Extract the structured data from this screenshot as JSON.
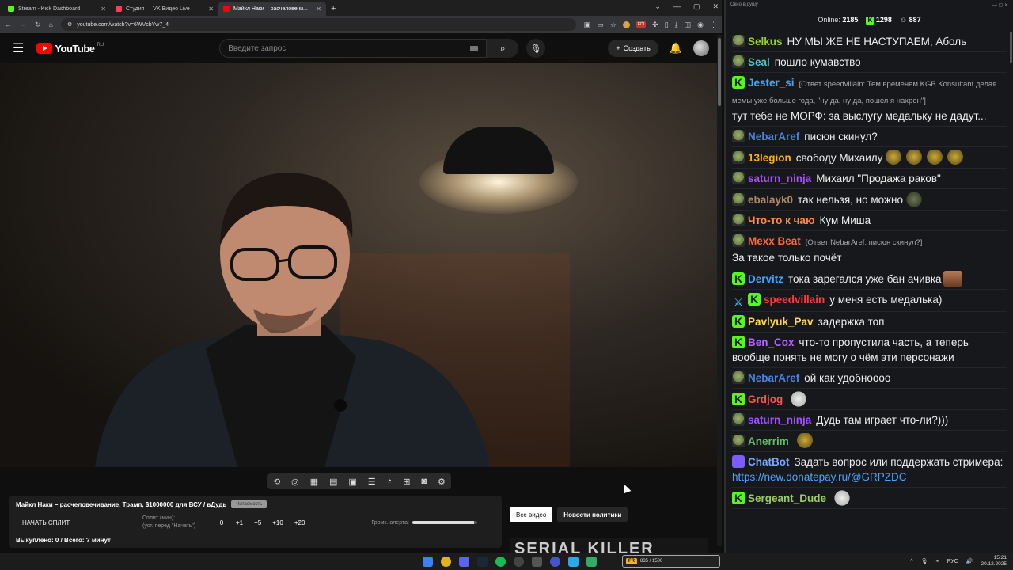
{
  "browser": {
    "tabs": [
      {
        "title": "Stream - Kick Dashboard",
        "color": "#53fc18",
        "active": false
      },
      {
        "title": "Студия — VK Видео Live",
        "color": "#ff3b5c",
        "active": false
      },
      {
        "title": "Майкл Наки – расчеловечи...",
        "color": "#ff0000",
        "active": true
      }
    ],
    "url": "youtube.com/watch?v=6WVcbYw7_4",
    "ext_badge": "EDI"
  },
  "youtube": {
    "logo_text": "YouTube",
    "region": "RU",
    "search_placeholder": "Введите запрос",
    "create_label": "Создать"
  },
  "panel": {
    "title": "Майкл Наки – расчеловечивание, Трамп, $1000000 для ВСУ / вДудь",
    "tag": "Читаемость",
    "start_split": "НАЧАТЬ СПЛИТ",
    "split_label": "Сплит (мин):",
    "split_hint": "(уст. перед \"Начать\")",
    "split_value": "0",
    "increments": [
      "+1",
      "+5",
      "+10",
      "+20"
    ],
    "alert_label": "Громк. алерта:",
    "alert_volume": 0.95,
    "footer": "Выкуплено: 0 / Всего: ? минут"
  },
  "chips": {
    "all": "Все видео",
    "policy": "Новости политики"
  },
  "thumb_text": "SERIAL KILLER",
  "chat": {
    "window_title": "Окно в душу",
    "online_label": "Online:",
    "online_count": "2185",
    "kick_count": "1298",
    "vk_count": "887",
    "messages": [
      {
        "badge": "pepe",
        "nick": "Selkus",
        "color": "#9acd32",
        "text": "НУ МЫ ЖЕ НЕ НАСТУПАЕМ, Аболь"
      },
      {
        "badge": "pepe",
        "nick": "Seal",
        "color": "#4fc3c3",
        "text": "пошло кумавство"
      },
      {
        "badge": "kick",
        "nick": "Jester_si",
        "color": "#3da8ff",
        "reply": "[Ответ speedvillain: Тем временем KGB Konsultant делая мемы уже больше года, \"ну да, ну да, пошел я нахрен\"]",
        "text": "тут тебе не МОРФ: за выслугу медальку не дадут..."
      },
      {
        "badge": "pepe",
        "nick": "NebarAref",
        "color": "#4a82e0",
        "text": "писюн скинул?"
      },
      {
        "badge": "pepe",
        "nick": "13legion",
        "color": "#ffb300",
        "text": "свободу  Михаилу",
        "emotes": 4
      },
      {
        "badge": "pepe",
        "nick": "saturn_ninja",
        "color": "#a64dff",
        "text": "Михаил \"Продажа раков\""
      },
      {
        "badge": "pepe",
        "nick": "ebalayk0",
        "color": "#b08968",
        "text": "так нельзя, но можно",
        "emote": "frog"
      },
      {
        "badge": "pepe",
        "nick": "Что-то к чаю",
        "color": "#ff8c42",
        "text": "Кум Миша"
      },
      {
        "badge": "pepe",
        "nick": "Mexx Beat",
        "color": "#ff6a3d",
        "reply": "[Ответ NebarAref: писюн скинул?]",
        "text": "За такое только почёт"
      },
      {
        "badge": "kick",
        "nick": "Dervitz",
        "color": "#3da8ff",
        "text": "тока зарегался уже бан ачивка",
        "emote": "face"
      },
      {
        "badge": "kick",
        "prebadge": "sword",
        "nick": "speedvillain",
        "color": "#ff3b3b",
        "text": "у меня есть медалька)"
      },
      {
        "badge": "kick",
        "nick": "Pavlyuk_Pav",
        "color": "#ffd54f",
        "text": "задержка топ"
      },
      {
        "badge": "kick",
        "nick": "Ben_Cox",
        "color": "#b561ff",
        "text": "что-то пропустила часть, а теперь вообще понять не могу о чём эти персонажи"
      },
      {
        "badge": "pepe",
        "nick": "NebarAref",
        "color": "#4a82e0",
        "text": "ой как удобноооо"
      },
      {
        "badge": "kick",
        "nick": "Grdjog",
        "color": "#ff5252",
        "text": "",
        "emote": "white"
      },
      {
        "badge": "pepe",
        "nick": "saturn_ninja",
        "color": "#a64dff",
        "text": "Дудь там играет что-ли?)))"
      },
      {
        "badge": "pepe",
        "nick": "Anerrim",
        "color": "#66bb6a",
        "text": "",
        "emote": "gold"
      },
      {
        "badge": "bot",
        "nick": "ChatBot",
        "color": "#7aa7ff",
        "text": "Задать вопрос или поддержать стримера:",
        "link": "https://new.donatepay.ru/@GRPZDC"
      },
      {
        "badge": "kick",
        "nick": "Sergeant_Dude",
        "color": "#9ccc65",
        "text": "",
        "emote": "white"
      }
    ]
  },
  "taskbar": {
    "widget_label": "FR",
    "widget_text": "835 / 1500",
    "lang": "РУС",
    "time": "15:21",
    "date": "20.12.2025"
  }
}
